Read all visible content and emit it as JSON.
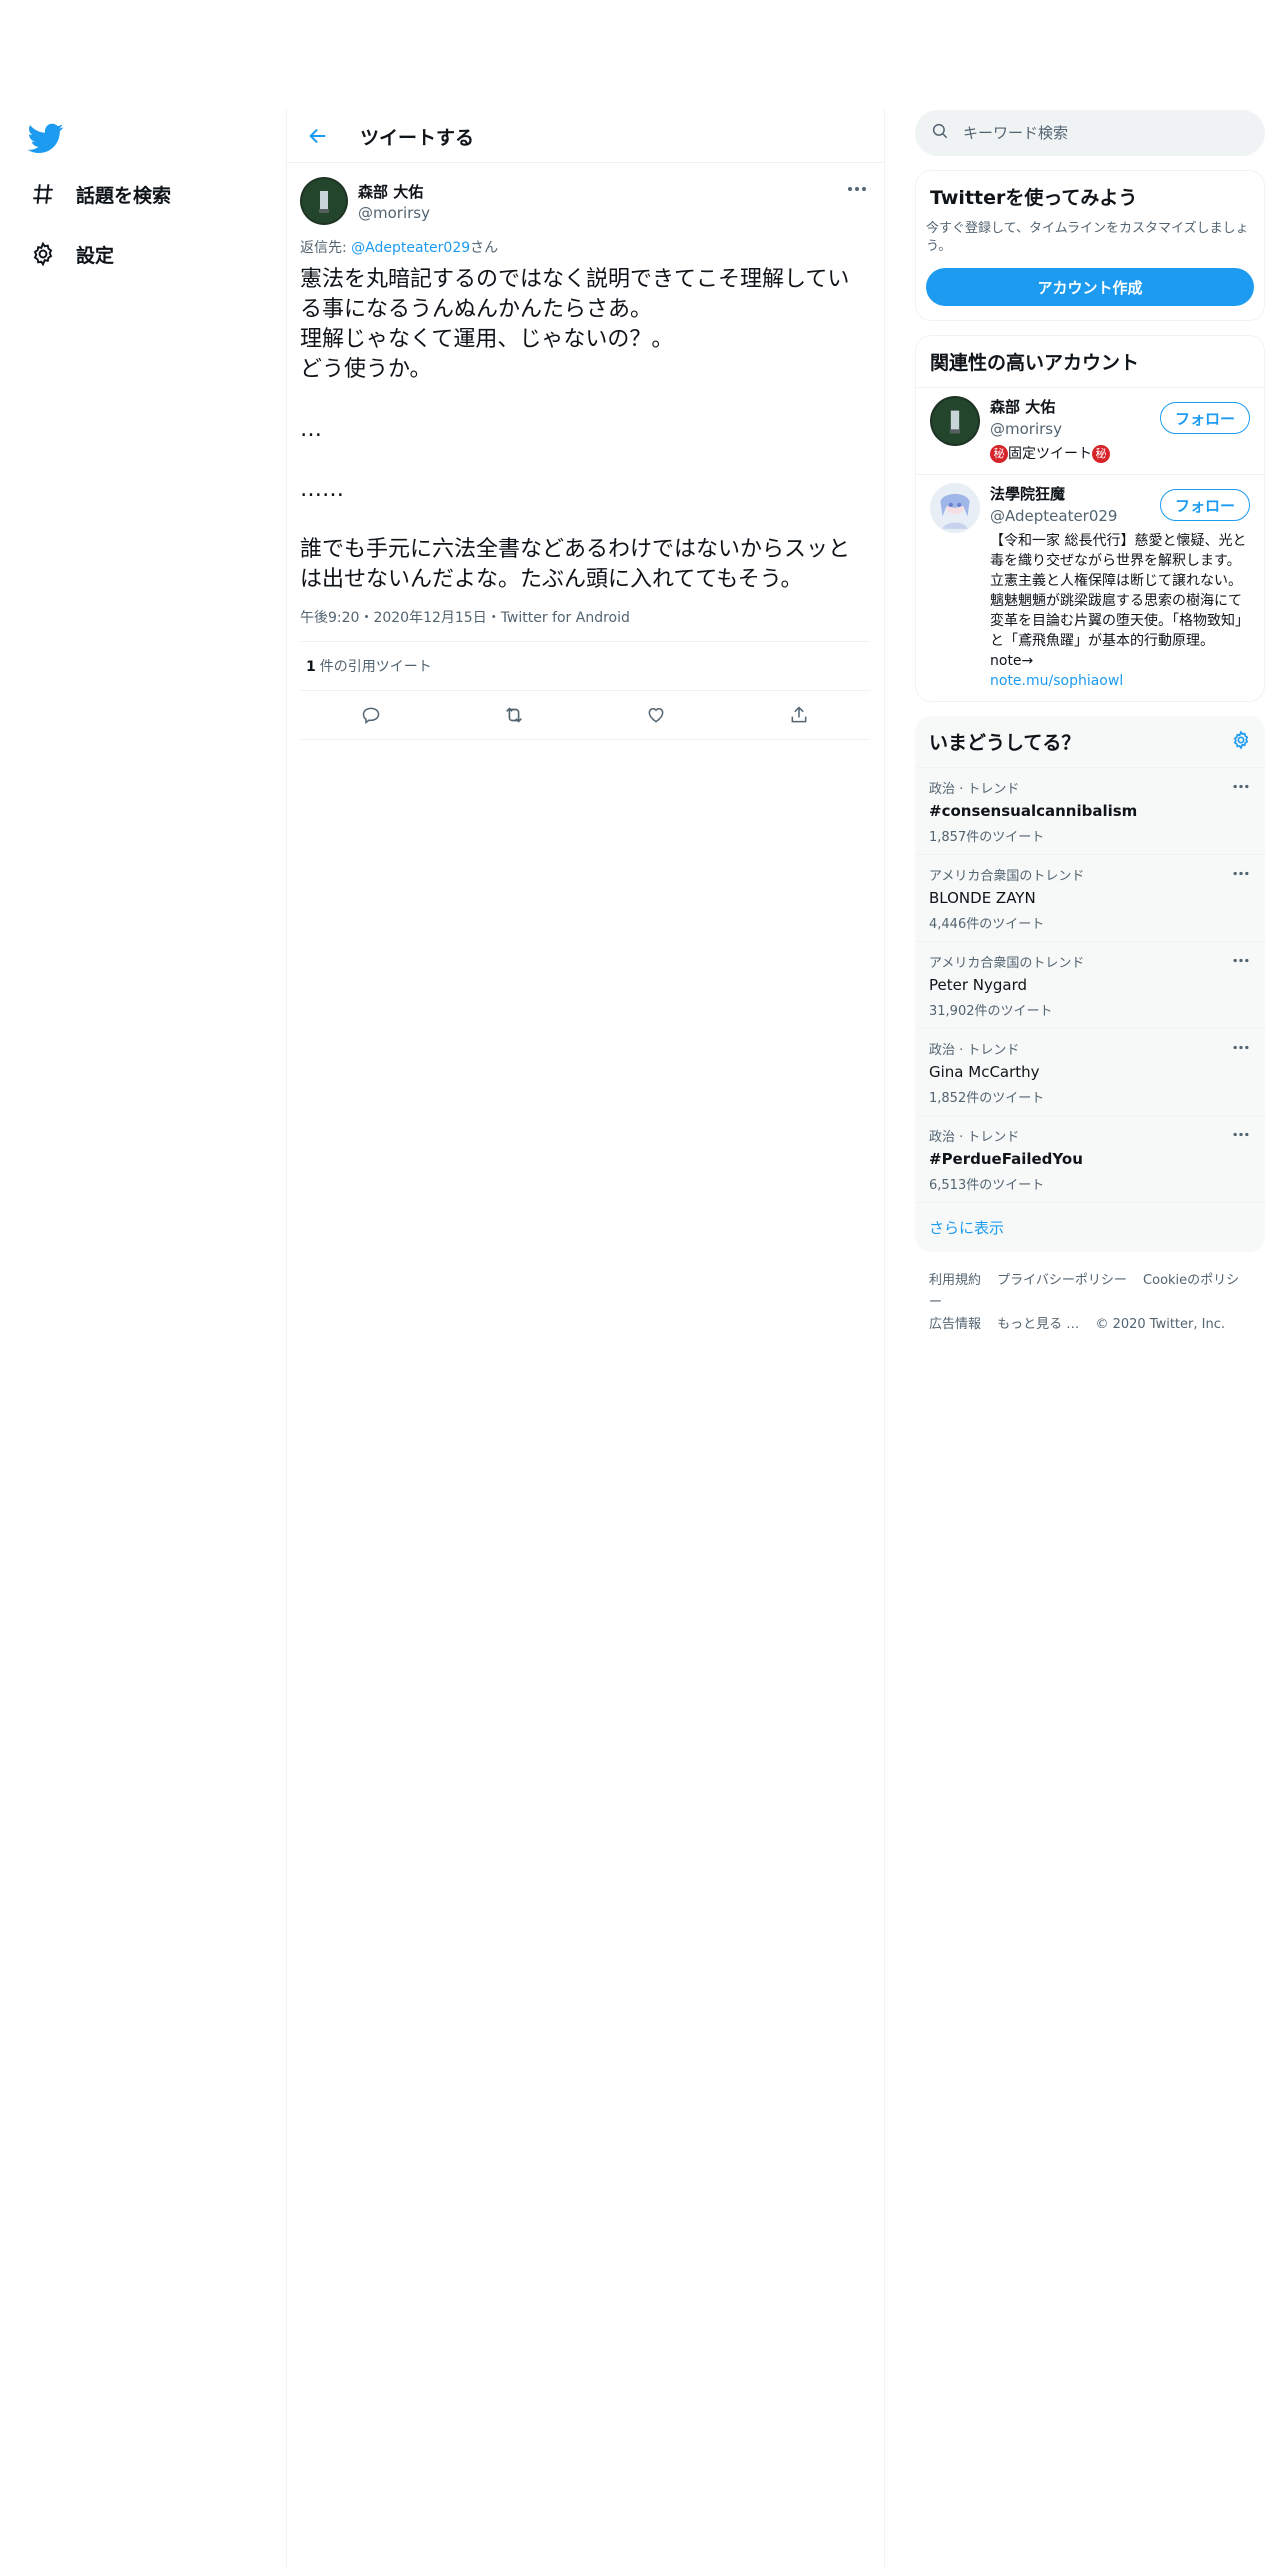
{
  "nav": {
    "explore_label": "話題を検索",
    "settings_label": "設定"
  },
  "header": {
    "title": "ツイートする"
  },
  "tweet": {
    "author_name": "森部 大佑",
    "author_handle": "@morirsy",
    "reply_prefix": "返信先: ",
    "reply_handle": "@Adepteater029",
    "reply_suffix": "さん",
    "text": "憲法を丸暗記するのではなく説明できてこそ理解している事になるうんぬんかんたらさあ。\n理解じゃなくて運用、じゃないの？。\nどう使うか。\n\n…\n\n……\n\n誰でも手元に六法全書などあるわけではないからスッとは出せないんだよな。たぶん頭に入れててもそう。",
    "meta": "午後9:20・2020年12月15日・Twitter for Android",
    "quote_count": "1",
    "quote_label": "件の引用ツイート"
  },
  "search": {
    "placeholder": "キーワード検索"
  },
  "signup": {
    "title": "Twitterを使ってみよう",
    "description": "今すぐ登録して、タイムラインをカスタマイズしましょう。",
    "button_label": "アカウント作成"
  },
  "related": {
    "title": "関連性の高いアカウント",
    "follow_label": "フォロー",
    "accounts": [
      {
        "name": "森部 大佑",
        "handle": "@morirsy",
        "bio_badge": "秘",
        "bio_text": "固定ツイート"
      },
      {
        "name": "法學院狂魔",
        "handle": "@Adepteater029",
        "bio_text": "【令和一家 総長代行】慈愛と懐疑、光と毒を織り交ぜながら世界を解釈します。立憲主義と人権保障は断じて譲れない。魑魅魍魎が跳梁跋扈する思索の樹海にて変革を目論む片翼の堕天使。「格物致知」と「鳶飛魚躍」が基本的行動原理。note→",
        "bio_link": "note.mu/sophiaowl"
      }
    ]
  },
  "trends": {
    "title": "いまどうしてる？",
    "items": [
      {
        "context": "政治 · トレンド",
        "name": "#consensualcannibalism",
        "count": "1,857件のツイート"
      },
      {
        "context": "アメリカ合衆国のトレンド",
        "name": "BLONDE ZAYN",
        "count": "4,446件のツイート"
      },
      {
        "context": "アメリカ合衆国のトレンド",
        "name": "Peter Nygard",
        "count": "31,902件のツイート"
      },
      {
        "context": "政治 · トレンド",
        "name": "Gina McCarthy",
        "count": "1,852件のツイート"
      },
      {
        "context": "政治 · トレンド",
        "name": "#PerdueFailedYou",
        "count": "6,513件のツイート"
      }
    ],
    "show_more": "さらに表示"
  },
  "footer": {
    "terms": "利用規約",
    "privacy": "プライバシーポリシー",
    "cookie": "Cookieのポリシー",
    "ads": "広告情報",
    "more": "もっと見る …",
    "copyright": "© 2020 Twitter, Inc."
  },
  "colors": {
    "accent": "#1d9bf0",
    "text": "#0f1419",
    "secondary": "#536471"
  }
}
